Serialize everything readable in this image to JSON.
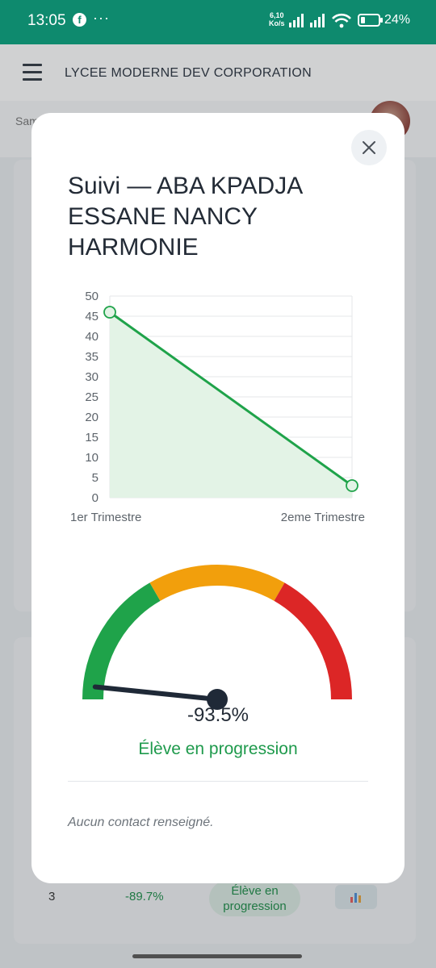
{
  "status_bar": {
    "time": "13:05",
    "notification_icons": [
      "facebook-icon",
      "more-dots-icon"
    ],
    "speed_value": "6,10",
    "speed_unit": "Ko/s",
    "battery_percent": "24%",
    "battery_level": 0.24
  },
  "app": {
    "title": "LYCEE MODERNE DEV CORPORATION",
    "subbar_text": "Sam",
    "row": {
      "index": "3",
      "evolution": "-89.7%",
      "status_line1": "Élève en",
      "status_line2": "progression"
    },
    "row_action_icon": "bar-chart-icon"
  },
  "modal": {
    "title": "Suivi — ABA KPADJA ESSANE NANCY HARMONIE",
    "close_icon": "close-icon",
    "gauge_value_text": "-93.5%",
    "gauge_value": -93.5,
    "gauge_range": [
      -100,
      100
    ],
    "gauge_colors": [
      "#1fa34a",
      "#f29f0c",
      "#dc2626"
    ],
    "status_text": "Élève en progression",
    "contact_text": "Aucun contact renseigné."
  },
  "chart_data": {
    "type": "area",
    "categories": [
      "1er Trimestre",
      "2eme Trimestre"
    ],
    "values": [
      46,
      3
    ],
    "ylim": [
      0,
      50
    ],
    "yticks": [
      0,
      5,
      10,
      15,
      20,
      25,
      30,
      35,
      40,
      45,
      50
    ],
    "grid": true,
    "color": "#1fa34a",
    "fill_color": "#e3f3e6"
  }
}
